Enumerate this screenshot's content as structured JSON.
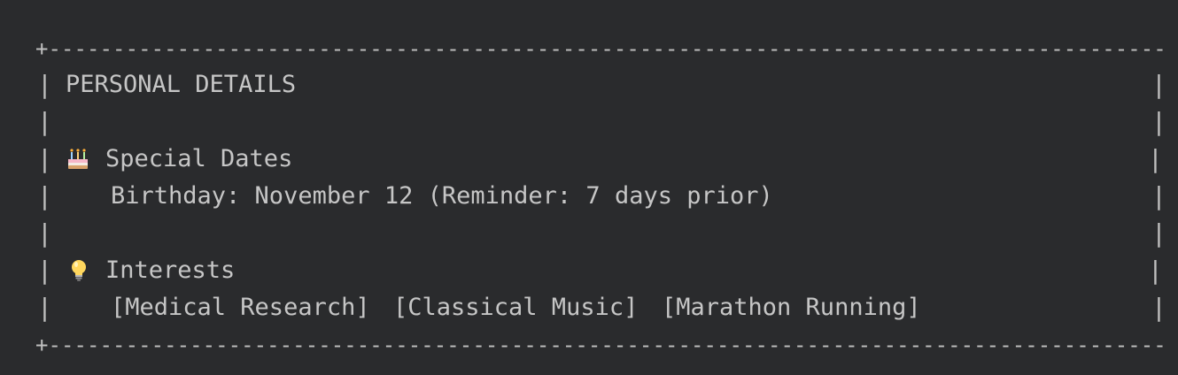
{
  "card": {
    "title": "PERSONAL DETAILS",
    "sections": [
      {
        "heading": "Special Dates",
        "icon": "birthday-cake-icon",
        "lines": [
          "Birthday: November 12 (Reminder: 7 days prior)"
        ]
      },
      {
        "heading": "Interests",
        "icon": "lightbulb-icon",
        "tags": [
          "[Medical Research]",
          "[Classical Music]",
          "[Marathon Running]"
        ]
      }
    ]
  },
  "colors": {
    "background": "#2a2b2d",
    "text": "#c6c6c6"
  }
}
